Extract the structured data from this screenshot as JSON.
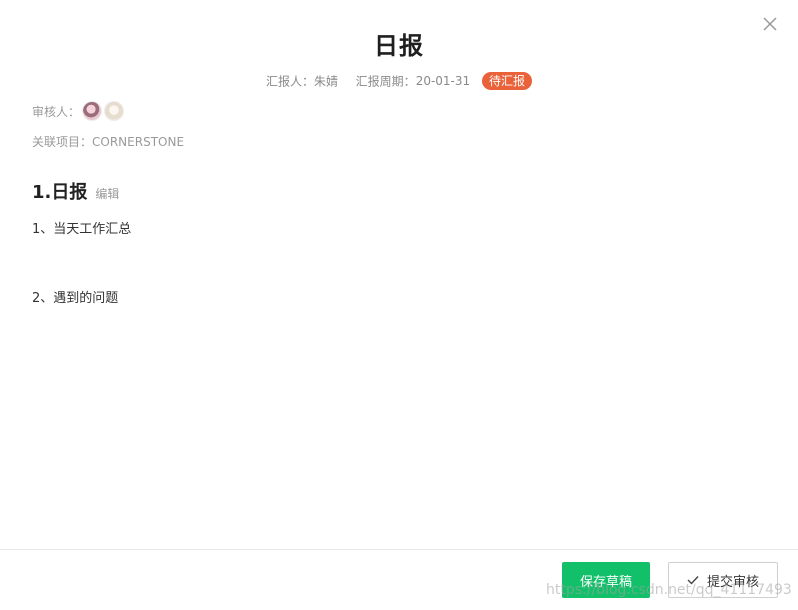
{
  "dialog": {
    "title": "日报",
    "close_icon": "close-icon"
  },
  "meta": {
    "reporter_label": "汇报人：",
    "reporter_name": "朱婧",
    "period_label": "汇报周期：",
    "period_value": "20-01-31",
    "status": "待汇报",
    "status_color": "#e9623a"
  },
  "reviewers": {
    "label": "审核人："
  },
  "project": {
    "label": "关联项目：",
    "value": "CORNERSTONE"
  },
  "section": {
    "title": "1.日报",
    "edit_label": "编辑",
    "items": [
      "1、当天工作汇总",
      "2、遇到的问题"
    ]
  },
  "footer": {
    "save_label": "保存草稿",
    "save_color": "#12c06a",
    "submit_label": "提交审核",
    "submit_icon": "check-icon"
  },
  "watermark": "https://blog.csdn.net/qq_41117493"
}
